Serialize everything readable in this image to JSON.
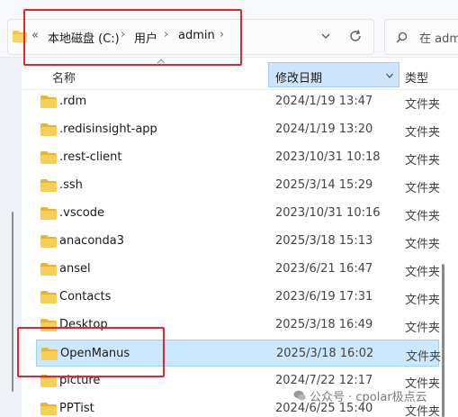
{
  "address_bar": {
    "back_chevrons": "«",
    "crumbs": [
      "本地磁盘 (C:)",
      "用户",
      "admin"
    ],
    "separator": "›",
    "dropdown_icon": "chevron-down-icon",
    "refresh_icon": "refresh-icon"
  },
  "search": {
    "placeholder": "在 adm"
  },
  "columns": {
    "name": "名称",
    "date": "修改日期",
    "type": "类型"
  },
  "rows": [
    {
      "name": ".rdm",
      "date": "2024/1/19 13:47",
      "type": "文件夹"
    },
    {
      "name": ".redisinsight-app",
      "date": "2024/1/19 13:20",
      "type": "文件夹"
    },
    {
      "name": ".rest-client",
      "date": "2023/10/31 10:18",
      "type": "文件夹"
    },
    {
      "name": ".ssh",
      "date": "2025/3/14 15:29",
      "type": "文件夹"
    },
    {
      "name": ".vscode",
      "date": "2023/10/31 10:16",
      "type": "文件夹"
    },
    {
      "name": "anaconda3",
      "date": "2025/3/18 15:13",
      "type": "文件夹"
    },
    {
      "name": "ansel",
      "date": "2023/6/21 16:47",
      "type": "文件夹"
    },
    {
      "name": "Contacts",
      "date": "2023/6/19 17:31",
      "type": "文件夹"
    },
    {
      "name": "Desktop",
      "date": "2025/3/18 16:49",
      "type": "文件夹"
    },
    {
      "name": "OpenManus",
      "date": "2025/3/18 16:02",
      "type": "文件夹",
      "selected": true
    },
    {
      "name": "picture",
      "date": "2024/7/22 12:17",
      "type": "文件夹"
    },
    {
      "name": "PPTist",
      "date": "2024/6/25 15:40",
      "type": "文件夹"
    }
  ],
  "watermark": "公众号 · cpolar极点云",
  "colors": {
    "folder": "#f5c542",
    "selected_bg": "#cce8ff",
    "header_sort_bg": "#cde4fb",
    "highlight": "#e8232a"
  }
}
